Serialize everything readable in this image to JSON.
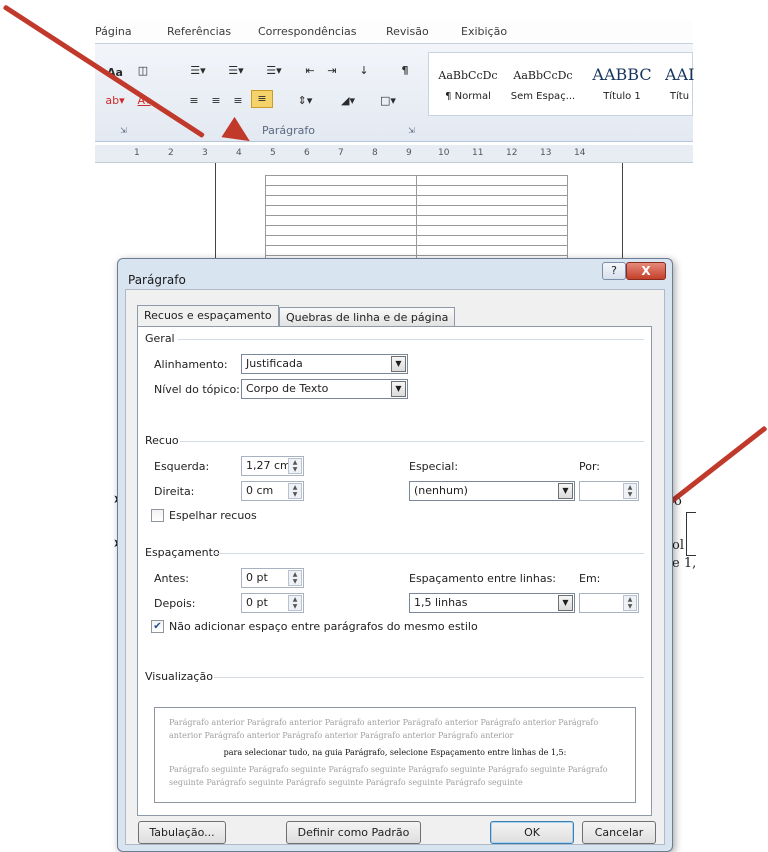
{
  "ribbon": {
    "tabs": [
      "Página",
      "Referências",
      "Correspondências",
      "Revisão",
      "Exibição"
    ],
    "group_label": "Parágrafo",
    "font_button": "Aa",
    "styles": [
      {
        "sample": "AaBbCcDc",
        "name": "¶ Normal"
      },
      {
        "sample": "AaBbCcDc",
        "name": "Sem Espaç..."
      },
      {
        "sample": "AABBC",
        "name": "Título 1"
      },
      {
        "sample": "AAI",
        "name": "Títu"
      }
    ]
  },
  "ruler": {
    "marks": [
      "1",
      "2",
      "3",
      "4",
      "5",
      "6",
      "7",
      "8",
      "9",
      "10",
      "11",
      "12",
      "13",
      "14"
    ]
  },
  "document": {
    "fragment_right_1": "o",
    "fragment_right_2": "ol",
    "fragment_right_3": "e 1,"
  },
  "dialog": {
    "title": "Parágrafo",
    "help_label": "?",
    "close_label": "X",
    "tabs": [
      "Recuos e espaçamento",
      "Quebras de linha e de página"
    ],
    "geral": {
      "section": "Geral",
      "alinhamento_label": "Alinhamento:",
      "alinhamento_value": "Justificada",
      "nivel_label": "Nível do tópico:",
      "nivel_value": "Corpo de Texto"
    },
    "recuo": {
      "section": "Recuo",
      "esquerda_label": "Esquerda:",
      "esquerda_value": "1,27 cm",
      "direita_label": "Direita:",
      "direita_value": "0 cm",
      "especial_label": "Especial:",
      "especial_value": "(nenhum)",
      "por_label": "Por:",
      "por_value": "",
      "espelhar_label": "Espelhar recuos",
      "espelhar_checked": false
    },
    "espacamento": {
      "section": "Espaçamento",
      "antes_label": "Antes:",
      "antes_value": "0 pt",
      "depois_label": "Depois:",
      "depois_value": "0 pt",
      "entre_linhas_label": "Espaçamento entre linhas:",
      "entre_linhas_value": "1,5 linhas",
      "em_label": "Em:",
      "em_value": "",
      "nao_adicionar_label": "Não adicionar espaço entre parágrafos do mesmo estilo",
      "nao_adicionar_checked": true
    },
    "visualizacao": {
      "section": "Visualização",
      "anterior": "Parágrafo anterior Parágrafo anterior Parágrafo anterior Parágrafo anterior Parágrafo anterior Parágrafo anterior Parágrafo anterior Parágrafo anterior Parágrafo anterior Parágrafo anterior",
      "atual": "para selecionar tudo, na guia Parágrafo, selecione Espaçamento entre linhas de 1,5:",
      "seguinte": "Parágrafo seguinte Parágrafo seguinte Parágrafo seguinte Parágrafo seguinte Parágrafo seguinte Parágrafo seguinte Parágrafo seguinte Parágrafo seguinte Parágrafo seguinte Parágrafo seguinte"
    },
    "buttons": {
      "tabulacao": "Tabulação...",
      "definir": "Definir como Padrão",
      "ok": "OK",
      "cancelar": "Cancelar"
    }
  },
  "colors": {
    "arrow": "#c0392b",
    "dialog_frame": "#d9e4f1",
    "close_button": "#c4402b"
  }
}
